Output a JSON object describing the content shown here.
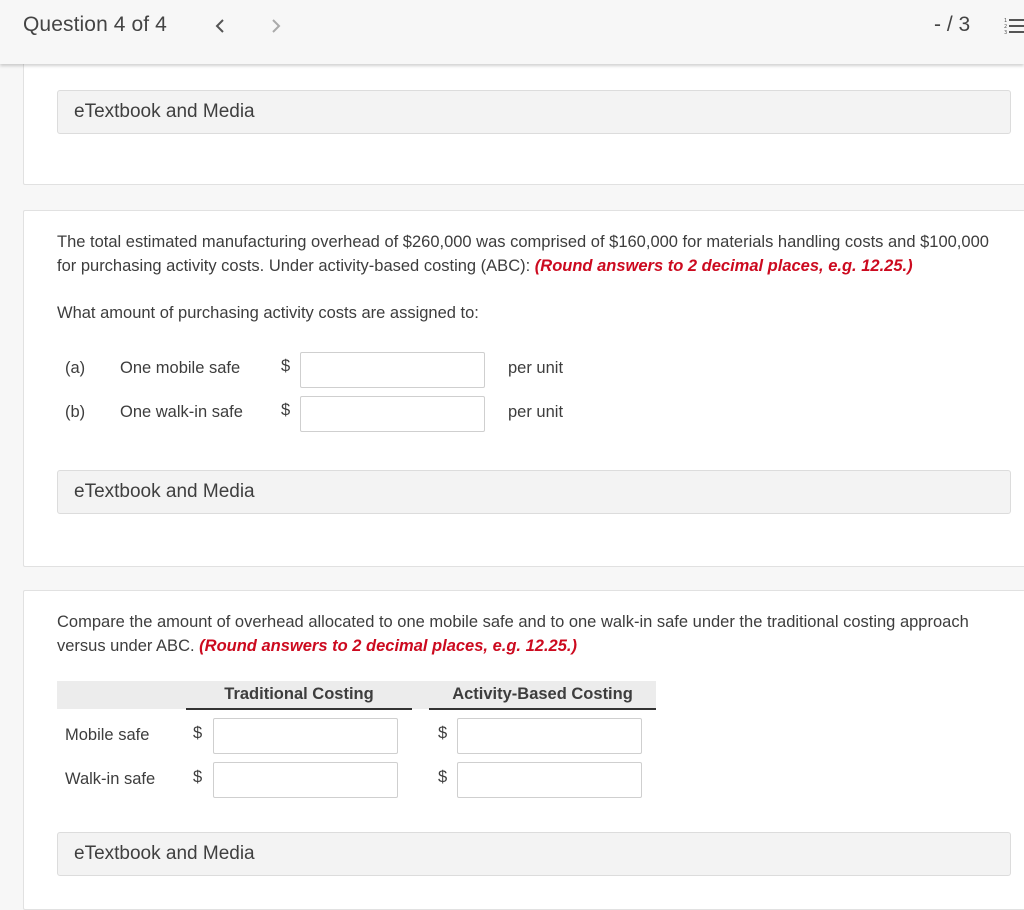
{
  "header": {
    "question_label": "Question 4 of 4",
    "score": "- / 3",
    "prev_icon": "chevron-left-icon",
    "next_icon": "chevron-right-icon",
    "list_icon": "numbered-list-icon"
  },
  "sections": [
    {
      "etextbook_label": "eTextbook and Media"
    },
    {
      "paragraph": "The total estimated manufacturing overhead of $260,000 was comprised of $160,000 for materials handling costs and $100,000 for purchasing activity costs. Under activity-based costing (ABC): ",
      "instruction": "(Round answers to 2 decimal places, e.g. 12.25.)",
      "question": "What amount of purchasing activity costs are assigned to:",
      "rows": [
        {
          "letter": "(a)",
          "label": "One mobile safe",
          "currency": "$",
          "value": "",
          "unit": "per unit"
        },
        {
          "letter": "(b)",
          "label": "One walk-in safe",
          "currency": "$",
          "value": "",
          "unit": "per unit"
        }
      ],
      "etextbook_label": "eTextbook and Media"
    },
    {
      "paragraph": "Compare the amount of overhead allocated to one mobile safe and to one walk-in safe under the traditional costing approach versus under ABC. ",
      "instruction": "(Round answers to 2 decimal places, e.g. 12.25.)",
      "table": {
        "headers": [
          "Traditional Costing",
          "Activity-Based Costing"
        ],
        "rows": [
          {
            "label": "Mobile safe",
            "currency": "$",
            "traditional": "",
            "abc": ""
          },
          {
            "label": "Walk-in safe",
            "currency": "$",
            "traditional": "",
            "abc": ""
          }
        ]
      },
      "etextbook_label": "eTextbook and Media"
    }
  ],
  "colors": {
    "instruction_red": "#cc0a1f",
    "background": "#f7f7f7",
    "etextbook_bg": "#f3f3f3"
  }
}
